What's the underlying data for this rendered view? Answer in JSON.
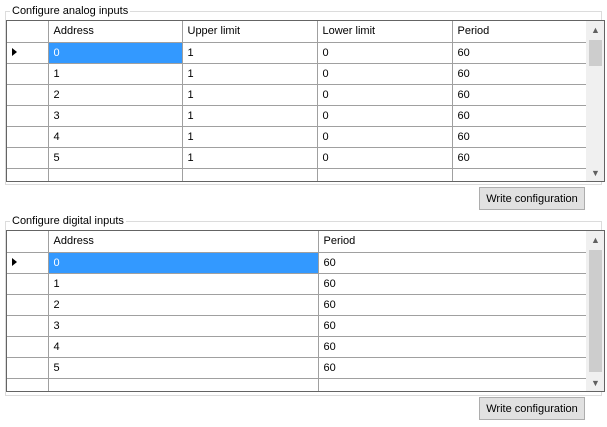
{
  "analog": {
    "title": "Configure analog inputs",
    "columns": [
      "Address",
      "Upper limit",
      "Lower limit",
      "Period"
    ],
    "rows": [
      [
        "0",
        "1",
        "0",
        "60"
      ],
      [
        "1",
        "1",
        "0",
        "60"
      ],
      [
        "2",
        "1",
        "0",
        "60"
      ],
      [
        "3",
        "1",
        "0",
        "60"
      ],
      [
        "4",
        "1",
        "0",
        "60"
      ],
      [
        "5",
        "1",
        "0",
        "60"
      ]
    ],
    "selected_row": 0,
    "button_label": "Write configuration"
  },
  "digital": {
    "title": "Configure digital inputs",
    "columns": [
      "Address",
      "Period"
    ],
    "rows": [
      [
        "0",
        "60"
      ],
      [
        "1",
        "60"
      ],
      [
        "2",
        "60"
      ],
      [
        "3",
        "60"
      ],
      [
        "4",
        "60"
      ],
      [
        "5",
        "60"
      ]
    ],
    "selected_row": 0,
    "button_label": "Write configuration"
  },
  "icons": {
    "current_row": "row-pointer-arrow-icon",
    "scroll_up": "chevron-up-icon",
    "scroll_down": "chevron-down-icon"
  }
}
